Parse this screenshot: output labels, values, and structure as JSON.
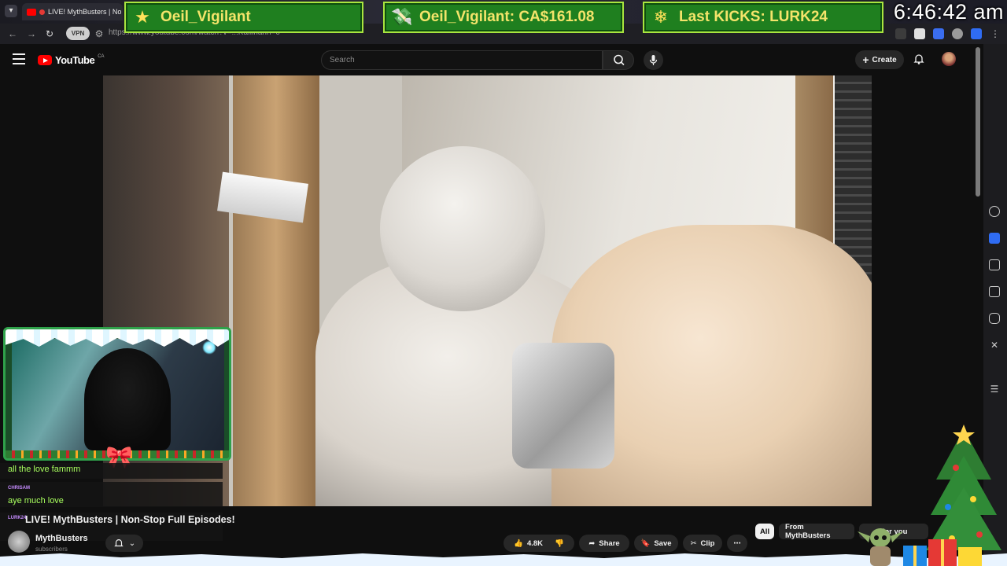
{
  "browser": {
    "tab_title": "LIVE! MythBusters | No",
    "url": "https://www.youtube.com/watch?v=...Kafilnanh=0"
  },
  "overlay": {
    "alerts": [
      {
        "text": "Oeil_Vigilant",
        "icon": "star-icon"
      },
      {
        "text": "Oeil_Vigilant: CA$161.08",
        "icon": "money-icon"
      },
      {
        "text": "Last KICKS: LURK24",
        "icon": "snowflake-icon"
      }
    ],
    "clock": "6:46:42 am"
  },
  "youtube": {
    "logo_text": "YouTube",
    "country": "CA",
    "search_placeholder": "Search",
    "create_label": "Create"
  },
  "chat": [
    {
      "user": "",
      "message": "all the love fammm"
    },
    {
      "user": "CHRISAM",
      "message": "aye much love"
    },
    {
      "user": "LURK24",
      "message": ""
    }
  ],
  "video": {
    "title": "LIVE! MythBusters | Non-Stop Full Episodes!",
    "channel": "MythBusters",
    "subscribers": "subscribers",
    "likes": "4.8K",
    "share_label": "Share",
    "save_label": "Save",
    "clip_label": "Clip"
  },
  "chips": [
    "All",
    "From MythBusters",
    "For you"
  ],
  "colors": {
    "alert_bg": "#1f7f1f",
    "alert_border": "#a9e53f",
    "alert_text": "#f4e46a",
    "chat_text": "#a8ff5e",
    "yt_red": "#ff0000"
  }
}
